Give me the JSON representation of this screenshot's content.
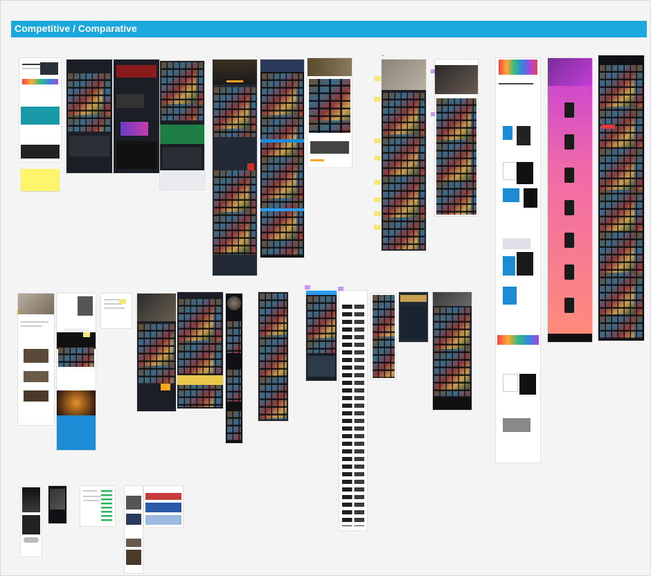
{
  "section": {
    "title": "Competitive / Comparative",
    "header_color": "#1ba8dc"
  },
  "canvas": {
    "background": "#f4f4f5"
  },
  "colors": {
    "sticky_yellow": "#fdf56b",
    "sticky_purple": "#c59bf0",
    "dark_screen": "#1b1e24",
    "pink_gradient_start": "#c43fd6",
    "pink_gradient_end": "#ff8d78"
  }
}
